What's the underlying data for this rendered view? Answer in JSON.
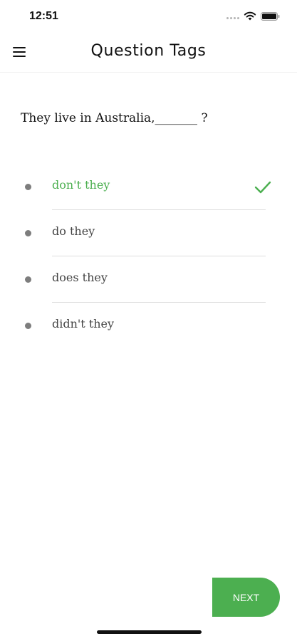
{
  "status_bar": {
    "time": "12:51"
  },
  "header": {
    "title": "Question Tags",
    "menu_icon": "hamburger-menu-icon"
  },
  "question": {
    "text": "They live in Australia,_______ ?"
  },
  "options": [
    {
      "label": "don't they",
      "selected": true,
      "correct": true
    },
    {
      "label": "do they",
      "selected": false,
      "correct": false
    },
    {
      "label": "does they",
      "selected": false,
      "correct": false
    },
    {
      "label": "didn't they",
      "selected": false,
      "correct": false
    }
  ],
  "next_button": {
    "label": "NEXT"
  },
  "colors": {
    "accent": "#4caf50",
    "bullet": "#7d7d7d",
    "divider": "#dedede"
  }
}
